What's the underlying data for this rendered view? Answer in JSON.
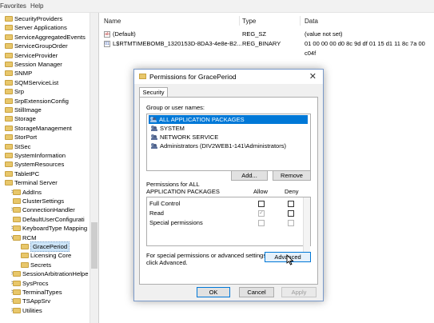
{
  "menubar": {
    "items": [
      "Favorites",
      "Help"
    ]
  },
  "tree": {
    "items": [
      {
        "label": "SecurityProviders",
        "exp": "",
        "indent": 0
      },
      {
        "label": "Server Applications",
        "exp": "",
        "indent": 0
      },
      {
        "label": "ServiceAggregatedEvents",
        "exp": "",
        "indent": 0
      },
      {
        "label": "ServiceGroupOrder",
        "exp": "",
        "indent": 0
      },
      {
        "label": "ServiceProvider",
        "exp": "",
        "indent": 0
      },
      {
        "label": "Session Manager",
        "exp": "",
        "indent": 0
      },
      {
        "label": "SNMP",
        "exp": "",
        "indent": 0
      },
      {
        "label": "SQMServiceList",
        "exp": "",
        "indent": 0
      },
      {
        "label": "Srp",
        "exp": "",
        "indent": 0
      },
      {
        "label": "SrpExtensionConfig",
        "exp": "",
        "indent": 0
      },
      {
        "label": "StillImage",
        "exp": "",
        "indent": 0
      },
      {
        "label": "Storage",
        "exp": "",
        "indent": 0
      },
      {
        "label": "StorageManagement",
        "exp": "",
        "indent": 0
      },
      {
        "label": "StorPort",
        "exp": "",
        "indent": 0
      },
      {
        "label": "StSec",
        "exp": "",
        "indent": 0
      },
      {
        "label": "SystemInformation",
        "exp": "",
        "indent": 0
      },
      {
        "label": "SystemResources",
        "exp": "",
        "indent": 0
      },
      {
        "label": "TabletPC",
        "exp": "",
        "indent": 0
      },
      {
        "label": "Terminal Server",
        "exp": "",
        "indent": 0
      },
      {
        "label": "AddIns",
        "exp": ">",
        "indent": 1
      },
      {
        "label": "ClusterSettings",
        "exp": "",
        "indent": 1
      },
      {
        "label": "ConnectionHandler",
        "exp": ">",
        "indent": 1
      },
      {
        "label": "DefaultUserConfigurati",
        "exp": "",
        "indent": 1
      },
      {
        "label": "KeyboardType Mapping",
        "exp": ">",
        "indent": 1
      },
      {
        "label": "RCM",
        "exp": "v",
        "indent": 1
      },
      {
        "label": "GracePeriod",
        "exp": "",
        "indent": 2,
        "selected": true
      },
      {
        "label": "Licensing Core",
        "exp": "",
        "indent": 2
      },
      {
        "label": "Secrets",
        "exp": "",
        "indent": 2
      },
      {
        "label": "SessionArbitrationHelpe",
        "exp": ">",
        "indent": 1
      },
      {
        "label": "SysProcs",
        "exp": ">",
        "indent": 1
      },
      {
        "label": "TerminalTypes",
        "exp": ">",
        "indent": 1
      },
      {
        "label": "TSAppSrv",
        "exp": ">",
        "indent": 1
      },
      {
        "label": "Utilities",
        "exp": ">",
        "indent": 1
      }
    ]
  },
  "list": {
    "headers": [
      "Name",
      "Type",
      "Data"
    ],
    "rows": [
      {
        "icon": "ab",
        "name": "(Default)",
        "type": "REG_SZ",
        "data": "(value not set)"
      },
      {
        "icon": "01",
        "name": "L$RTMTIMEBOMB_1320153D-8DA3-4e8e-B2...",
        "type": "REG_BINARY",
        "data": "01 00 00 00 d0 8c 9d df 01 15 d1 11 8c 7a 00 c04f"
      }
    ]
  },
  "dialog": {
    "title": "Permissions for GracePeriod",
    "close": "✕",
    "tab": "Security",
    "group_label": "Group or user names:",
    "users": [
      "ALL APPLICATION PACKAGES",
      "SYSTEM",
      "NETWORK SERVICE",
      "Administrators (DIV2WEB1-141\\Administrators)"
    ],
    "add": "Add...",
    "remove": "Remove",
    "perm_label_1": "Permissions for ALL",
    "perm_label_2": "APPLICATION PACKAGES",
    "allow": "Allow",
    "deny": "Deny",
    "permissions": [
      {
        "name": "Full Control",
        "allow": false,
        "deny": false
      },
      {
        "name": "Read",
        "allow": true,
        "deny": false
      },
      {
        "name": "Special permissions",
        "allow": false,
        "deny": false
      }
    ],
    "special_1": "For special permissions or advanced settings,",
    "special_2": "click Advanced.",
    "advanced": "Advanced",
    "ok": "OK",
    "cancel": "Cancel",
    "apply": "Apply"
  }
}
